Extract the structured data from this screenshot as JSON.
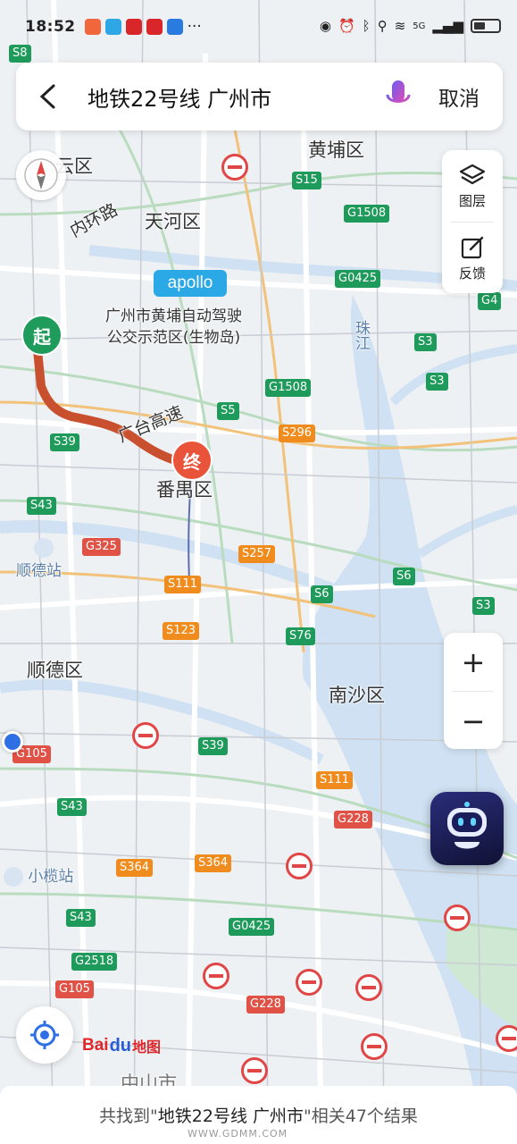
{
  "status_bar": {
    "time": "18:52",
    "network": "5G",
    "icons": [
      "eye-icon",
      "alarm-icon",
      "bluetooth-icon",
      "location-icon",
      "wifi-icon",
      "signal-icon",
      "battery-icon"
    ]
  },
  "search": {
    "back_icon": "back-arrow-icon",
    "query": "地铁22号线 广州市",
    "mic_icon": "microphone-icon",
    "cancel_label": "取消"
  },
  "side_panel": {
    "layers_label": "图层",
    "feedback_label": "反馈"
  },
  "zoom": {
    "in_label": "+",
    "out_label": "−"
  },
  "map": {
    "districts": [
      "黄埔区",
      "天河区",
      "番禺区",
      "顺德区",
      "南沙区",
      "云区",
      "中山市"
    ],
    "roads": [
      "内环路",
      "广台高速"
    ],
    "rivers": [
      "珠江"
    ],
    "stations": [
      "顺德站",
      "小榄站"
    ],
    "poi": [
      "广州市黄埔自动驾驶",
      "公交示范区(生物岛)"
    ],
    "apollo_label": "apollo",
    "route_start_label": "起",
    "route_end_label": "终",
    "shields": [
      "S8",
      "S15",
      "G1508",
      "G0425",
      "G4",
      "S3",
      "S3",
      "S3",
      "G1508",
      "S5",
      "S296",
      "S39",
      "S43",
      "G325",
      "S257",
      "S111",
      "S6",
      "S6",
      "S123",
      "S76",
      "S39",
      "S111",
      "G105",
      "S43",
      "G228",
      "S364",
      "S364",
      "S43",
      "G0425",
      "G2518",
      "G105",
      "G228"
    ]
  },
  "logo": {
    "bai": "Bai",
    "paw": "du",
    "ditu": "地图"
  },
  "result": {
    "prefix": "共找到\"",
    "query": "地铁22号线 广州市",
    "suffix": "\"相关47个结果"
  },
  "watermark": "WWW.GDMM.COM",
  "colors": {
    "route": "#c8502e",
    "start_pin": "#1f9b5c",
    "end_pin": "#e8533a",
    "accent_blue": "#2f6fe6"
  }
}
